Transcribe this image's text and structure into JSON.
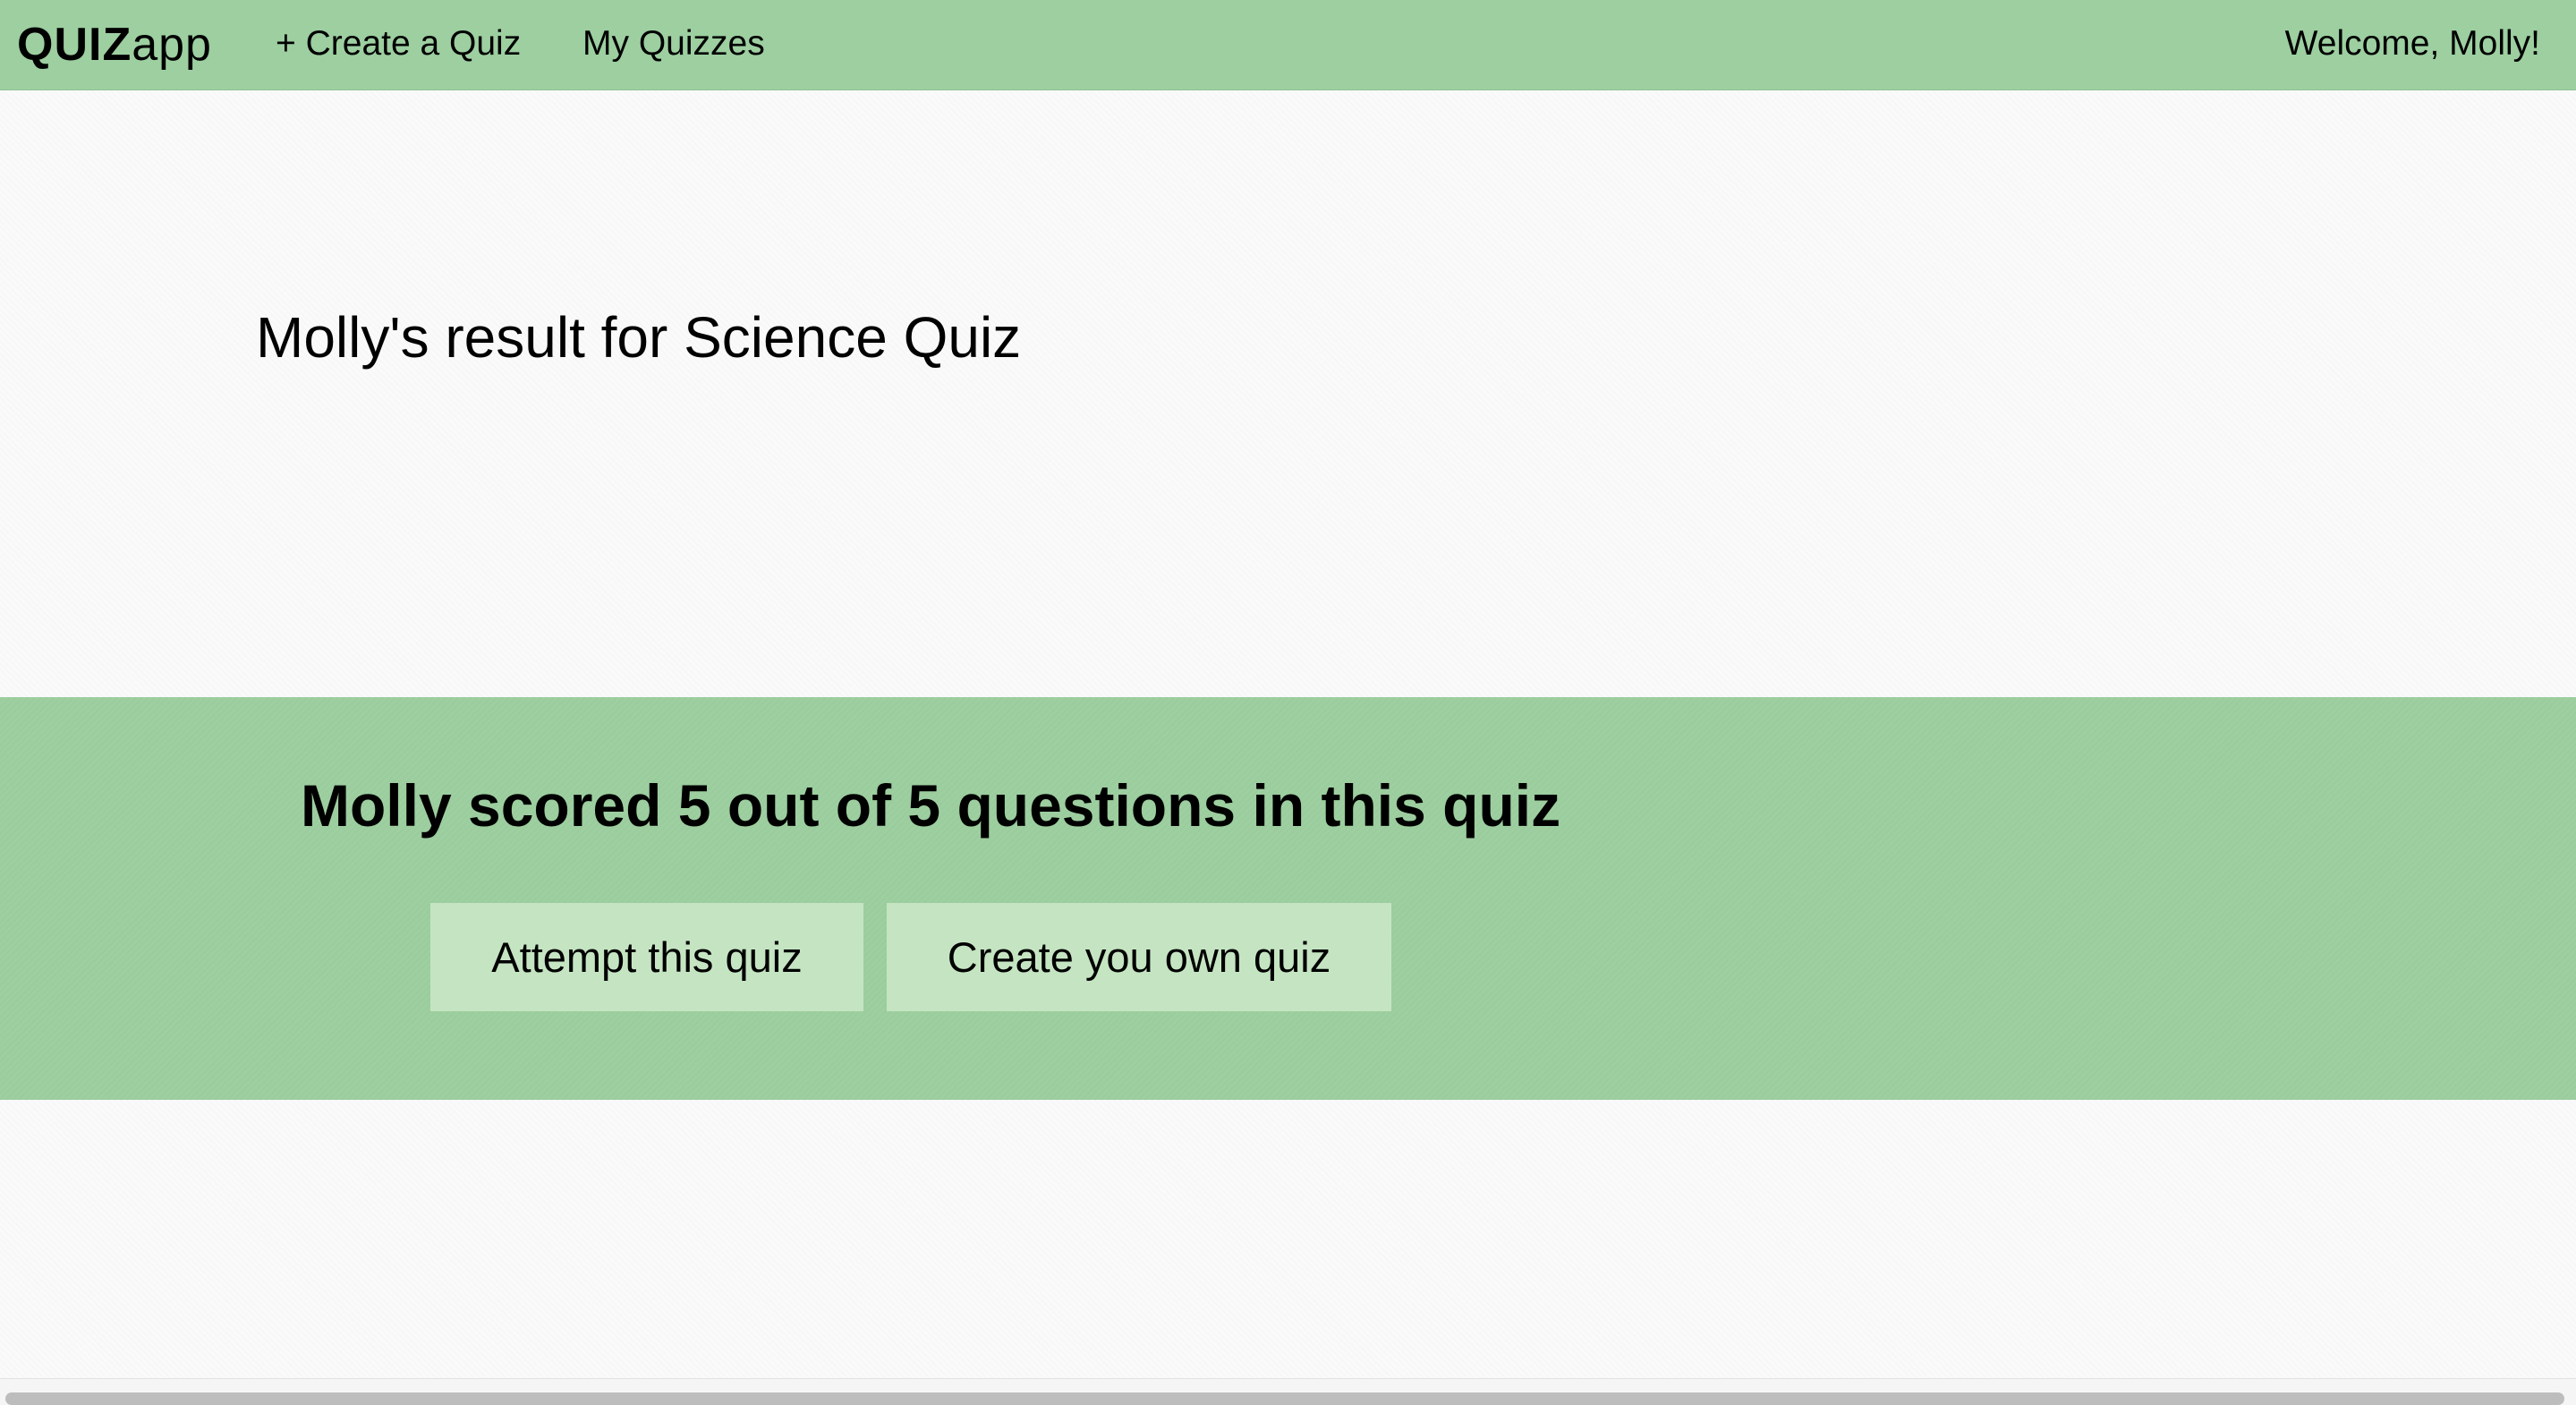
{
  "navbar": {
    "brand_bold": "QUIZ",
    "brand_light": "app",
    "create_link": "+ Create a Quiz",
    "my_quizzes_link": "My Quizzes",
    "welcome": "Welcome, Molly!"
  },
  "main": {
    "title": "Molly's result for Science Quiz"
  },
  "result": {
    "score_text": "Molly scored 5 out of 5 questions in this quiz",
    "attempt_button": "Attempt this quiz",
    "create_button": "Create you own quiz"
  },
  "colors": {
    "accent_green": "#9dcfa0",
    "button_green": "#c5e5c2",
    "page_background": "#fafafa"
  }
}
